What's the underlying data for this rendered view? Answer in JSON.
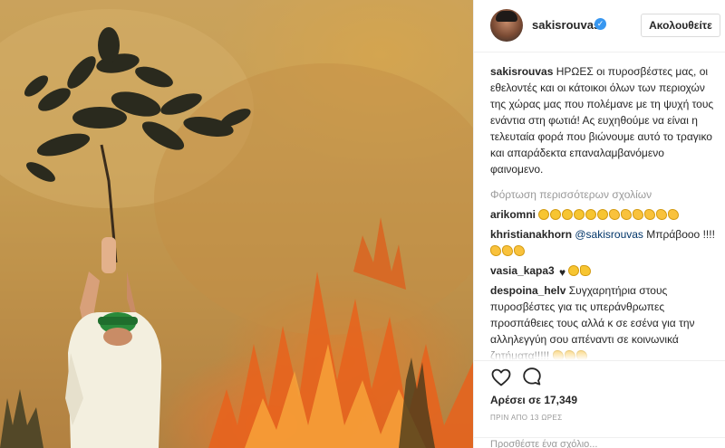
{
  "post": {
    "photo_alt": "firefighter-holding-branch-in-wildfire"
  },
  "header": {
    "username": "sakisrouvas",
    "verified_mark": "✓",
    "follow_label": "Ακολουθείτε"
  },
  "caption": {
    "username": "sakisrouvas",
    "text": "ΗΡΩΕΣ οι πυροσβέστες μας, οι εθελοντές και οι κάτοικοι όλων των περιοχών της χώρας μας που πολέμανε με τη ψυχή τους ενάντια στη φωτιά! Ας ευχηθούμε να είναι η τελευταία φορά που βιώνουμε αυτό το τραγικο και απαράδεκτα επαναλαμβανόμενο φαινομενο."
  },
  "load_more": "Φόρτωση περισσότερων σχολίων",
  "comments": [
    {
      "username": "arikomni",
      "mention": "",
      "text": "",
      "emojis": [
        "cry",
        "cry",
        "cry",
        "cry",
        "cry",
        "cry",
        "hand",
        "hand",
        "hand",
        "hand",
        "hand",
        "hand"
      ]
    },
    {
      "username": "khristianakhorn",
      "mention": "@sakisrouvas",
      "text": "Μπράβοοο !!!!",
      "emojis": [
        "hand",
        "hand",
        "hand"
      ]
    },
    {
      "username": "vasia_kapa3",
      "mention": "",
      "text": "",
      "emojis": [
        "heart",
        "cry",
        "muscle"
      ]
    },
    {
      "username": "despoina_helv",
      "mention": "",
      "text": "Συγχαρητήρια στους πυροσβέστες για τις υπεράνθρωπες προσπάθειες τους αλλά κ σε εσένα για την αλληλεγγύη σου απέναντι σε κοινωνικά ζητήματα!!!!!",
      "emojis": [
        "hand",
        "hand",
        "hand"
      ]
    }
  ],
  "actions": {
    "likes": "Αρέσει σε 17,349",
    "time": "ΠΡΙΝ ΑΠΟ 13 ΩΡΕΣ",
    "add_comment": "Προσθέστε ένα σχόλιο..."
  },
  "icons": {
    "like": "heart-outline-icon",
    "comment": "speech-bubble-icon"
  },
  "colors": {
    "verified": "#3897f0",
    "link": "#003569",
    "muted": "#999999"
  }
}
